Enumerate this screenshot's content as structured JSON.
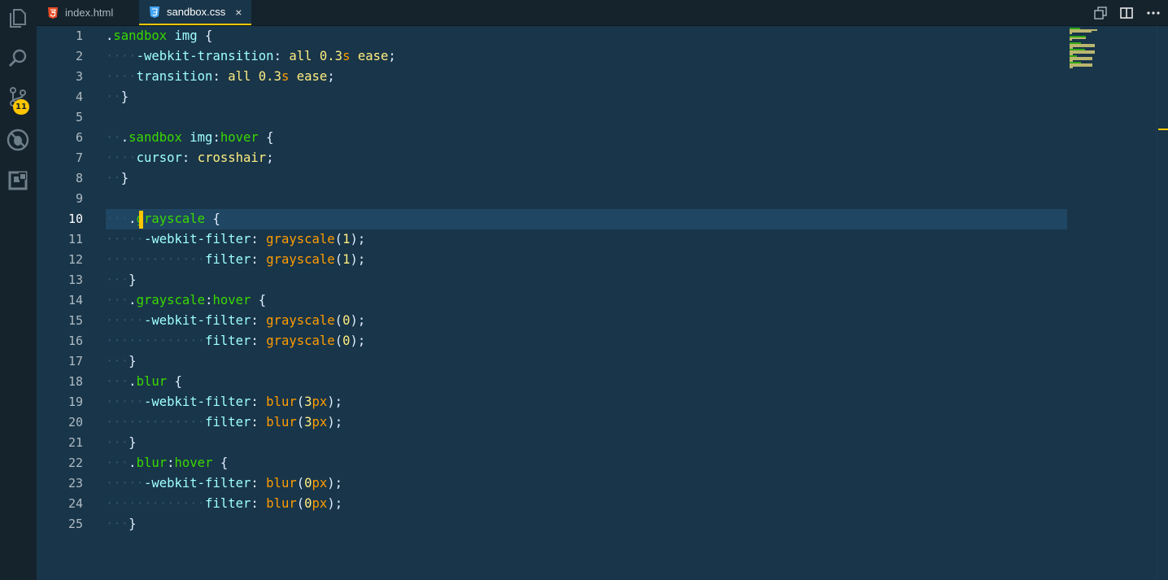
{
  "activity_bar": {
    "items": [
      {
        "name": "explorer-icon"
      },
      {
        "name": "search-icon"
      },
      {
        "name": "source-control-icon",
        "badge": "11"
      },
      {
        "name": "debug-icon"
      },
      {
        "name": "extensions-icon"
      }
    ]
  },
  "tabs": [
    {
      "label": "index.html",
      "icon": "html5-icon",
      "active": false
    },
    {
      "label": "sandbox.css",
      "icon": "css3-icon",
      "active": true,
      "close": "×"
    }
  ],
  "editor": {
    "current_line": 10,
    "line_numbers": [
      "1",
      "2",
      "3",
      "4",
      "5",
      "6",
      "7",
      "8",
      "9",
      "10",
      "11",
      "12",
      "13",
      "14",
      "15",
      "16",
      "17",
      "18",
      "19",
      "20",
      "21",
      "22",
      "23",
      "24",
      "25"
    ],
    "lines": [
      ".sandbox img {",
      "    -webkit-transition: all 0.3s ease;",
      "    transition: all 0.3s ease;",
      "  }",
      "",
      "  .sandbox img:hover {",
      "    cursor: crosshair;",
      "  }",
      "",
      "   .grayscale {",
      "     -webkit-filter: grayscale(1);",
      "             filter: grayscale(1);",
      "   }",
      "   .grayscale:hover {",
      "     -webkit-filter: grayscale(0);",
      "             filter: grayscale(0);",
      "   }",
      "   .blur {",
      "     -webkit-filter: blur(3px);",
      "             filter: blur(3px);",
      "   }",
      "   .blur:hover {",
      "     -webkit-filter: blur(0px);",
      "             filter: blur(0px);",
      "   }"
    ]
  },
  "colors": {
    "background": "#193549",
    "activity_bar": "#15232d",
    "accent": "#ffc600",
    "selector": "#3ad900",
    "property": "#9effff",
    "function": "#ff9d00",
    "value": "#ffee80"
  }
}
